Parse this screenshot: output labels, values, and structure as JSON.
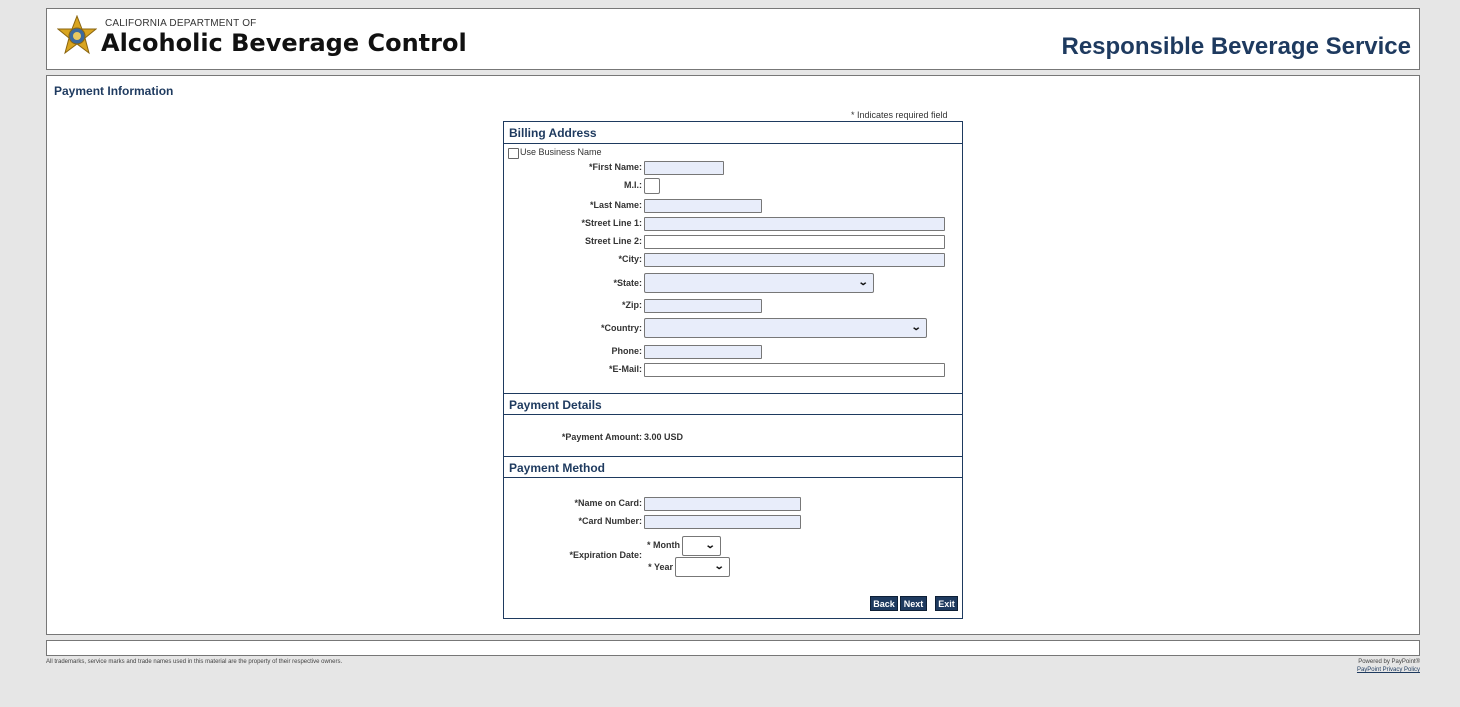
{
  "header": {
    "dept_small": "CALIFORNIA DEPARTMENT OF",
    "dept_big": "Alcoholic Beverage Control",
    "site_title": "Responsible Beverage Service"
  },
  "page": {
    "heading": "Payment Information",
    "required_note": "* Indicates required field"
  },
  "billing": {
    "title": "Billing Address",
    "use_business_name": "Use Business Name",
    "first_name": "*First Name:",
    "mi": "M.I.:",
    "last_name": "*Last Name:",
    "street1": "*Street Line 1:",
    "street2": "Street Line 2:",
    "city": "*City:",
    "state": "*State:",
    "zip": "*Zip:",
    "country": "*Country:",
    "phone": "Phone:",
    "email": "*E-Mail:"
  },
  "payment_details": {
    "title": "Payment Details",
    "amount_label": "*Payment Amount:",
    "amount_value": "3.00 USD"
  },
  "payment_method": {
    "title": "Payment Method",
    "name_on_card": "*Name on Card:",
    "card_number": "*Card Number:",
    "expiration": "*Expiration Date:",
    "month": "* Month",
    "year": "* Year"
  },
  "buttons": {
    "back": "Back",
    "next": "Next",
    "exit": "Exit"
  },
  "footer": {
    "trademark": "All trademarks, service marks and trade names used in this material are the property of their respective owners.",
    "powered": "Powered by PayPoint®",
    "privacy": "PayPoint Privacy Policy"
  },
  "colors": {
    "accent": "#1e3a5f",
    "input_fill": "#e8edfa",
    "page_bg": "#e6e6e6"
  }
}
